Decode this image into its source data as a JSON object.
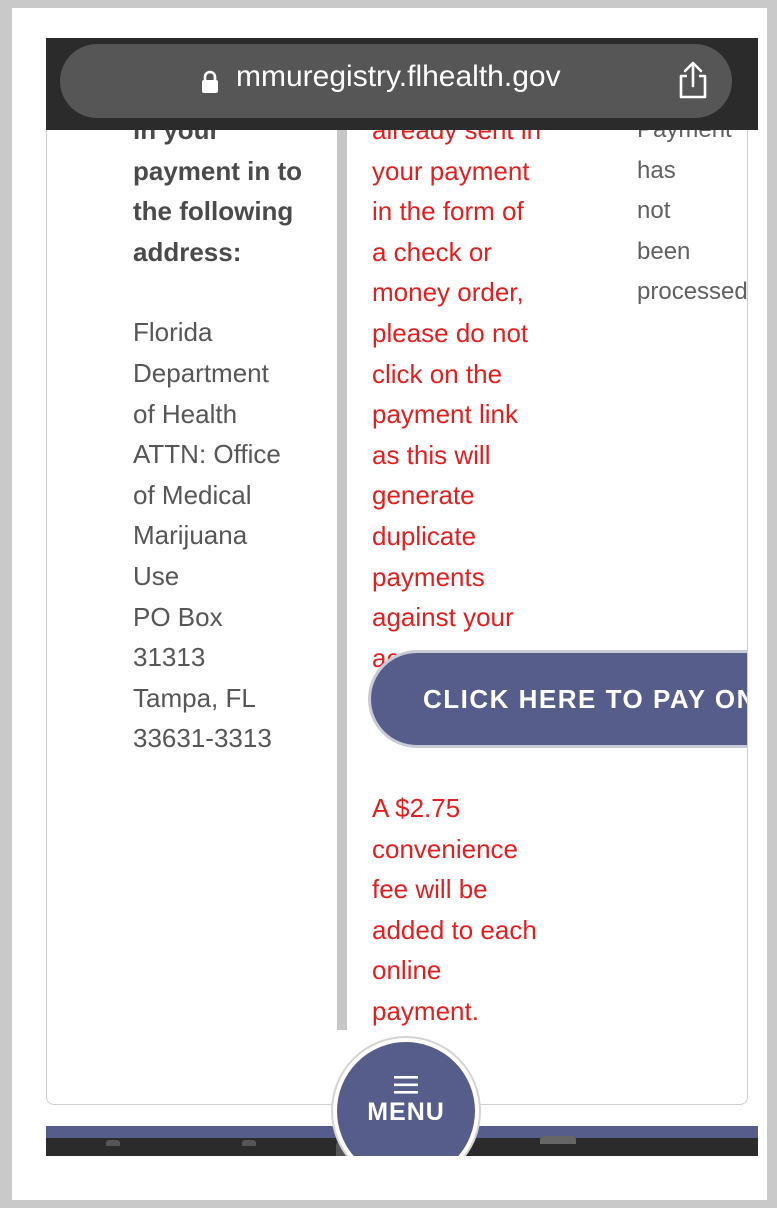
{
  "browser": {
    "url": "mmuregistry.flhealth.gov"
  },
  "column1": {
    "heading_lines": [
      "in your",
      "payment in to",
      "the following",
      "address:"
    ],
    "address_lines": [
      "Florida",
      "Department",
      "of Health",
      "ATTN: Office",
      "of Medical",
      "Marijuana",
      "Use",
      "PO Box",
      "31313",
      "Tampa, FL",
      "33631-3313"
    ]
  },
  "column2": {
    "warning_lines": [
      "already sent in",
      "your payment",
      "in the form of",
      "a check or",
      "money order,",
      "please do not",
      "click on the",
      "payment link",
      "as this will",
      "generate",
      "duplicate",
      "payments",
      "against your",
      "account."
    ],
    "pay_button_label": "CLICK HERE TO PAY ONLINE",
    "fee_lines": [
      "A $2.75",
      "convenience",
      "fee will be",
      "added to each",
      "online",
      "payment."
    ]
  },
  "column3": {
    "status_lines": [
      "Payment",
      "has",
      "not",
      "been",
      "processed"
    ]
  },
  "menu": {
    "label": "MENU"
  },
  "colors": {
    "accent": "#575d8a",
    "warning": "#e02020"
  }
}
